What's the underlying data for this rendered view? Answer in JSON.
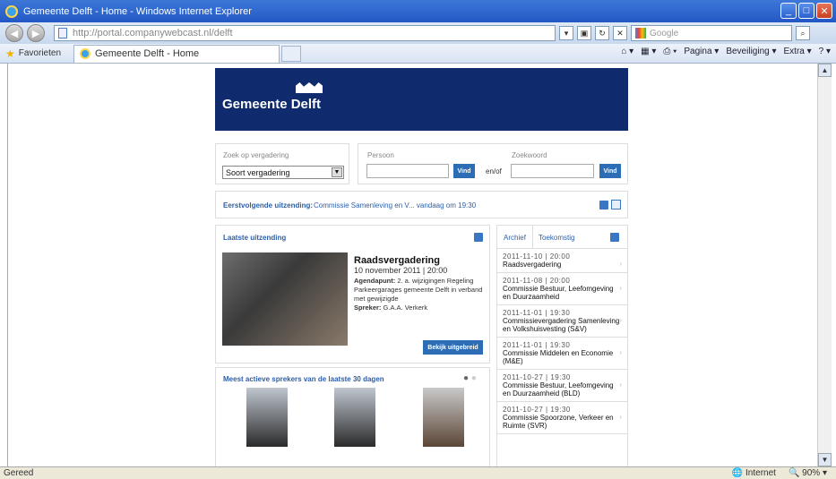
{
  "window": {
    "title": "Gemeente Delft - Home - Windows Internet Explorer"
  },
  "address": {
    "url": "http://portal.companywebcast.nl/delft",
    "search_placeholder": "Google"
  },
  "favorites": {
    "label": "Favorieten",
    "tab": "Gemeente Delft - Home",
    "cmds": [
      "Pagina ▾",
      "Beveiliging ▾",
      "Extra ▾"
    ]
  },
  "status": {
    "text": "Gereed",
    "zone": "Internet",
    "zoom": "90%"
  },
  "site": {
    "logo": "Gemeente Delft"
  },
  "search": {
    "meeting_label": "Zoek op vergadering",
    "meeting_select": "Soort vergadering",
    "person_label": "Persoon",
    "keyword_label": "Zoekwoord",
    "vind": "Vind",
    "or": "en/of"
  },
  "next": {
    "label": "Eerstvolgende uitzending:",
    "text": "Commissie Samenleving en V...  vandaag om 19:30"
  },
  "latest": {
    "heading": "Laatste uitzending",
    "title": "Raadsvergadering",
    "datetime": "10 november 2011 | 20:00",
    "agenda_label": "Agendapunt:",
    "agenda": "2. a. wijzigingen Regeling Parkeergarages gemeente Delft in verband met gewijzigde",
    "speaker_label": "Spreker:",
    "speaker": "G.A.A. Verkerk",
    "button": "Bekijk uitgebreid"
  },
  "speakers": {
    "heading": "Meest actieve sprekers van de laatste 30 dagen"
  },
  "archive": {
    "tabs": [
      "Archief",
      "Toekomstig"
    ],
    "items": [
      {
        "date": "2011-11-10 | 20:00",
        "title": "Raadsvergadering"
      },
      {
        "date": "2011-11-08 | 20:00",
        "title": "Commissie Bestuur, Leefomgeving en Duurzaamheid"
      },
      {
        "date": "2011-11-01 | 19:30",
        "title": "Commissievergadering Samenleving en Volkshuisvesting (S&V)"
      },
      {
        "date": "2011-11-01 | 19:30",
        "title": "Commissie Middelen en Economie (M&E)"
      },
      {
        "date": "2011-10-27 | 19:30",
        "title": "Commissie Bestuur, Leefomgeving en Duurzaamheid (BLD)"
      },
      {
        "date": "2011-10-27 | 19:30",
        "title": "Commissie Spoorzone, Verkeer en Ruimte (SVR)"
      }
    ]
  }
}
